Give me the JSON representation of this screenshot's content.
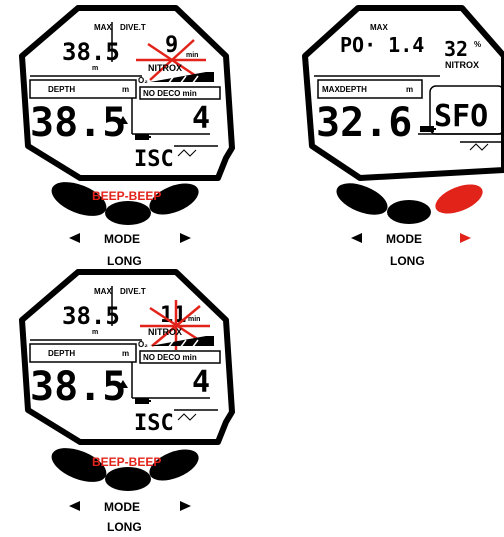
{
  "panel1": {
    "max_label": "MAX",
    "dive_t_label": "DIVE.T",
    "max_depth": "38.5",
    "unit_m": "m",
    "dive_time": "9",
    "unit_min": "min",
    "nitrox_label": "NITROX",
    "o2_label": "O₂",
    "depth_label": "DEPTH",
    "depth_unit": "m",
    "no_deco_label": "NO DECO min",
    "depth_value": "38.5",
    "no_deco_value": "4",
    "isc_text": "ISC",
    "beep_text": "BEEP-BEEP",
    "mode_text": "MODE",
    "long_text": "LONG"
  },
  "panel2": {
    "max_label": "MAX",
    "po_value": "PO· 1.4",
    "o2_percent": "32",
    "percent_sign": "%",
    "nitrox_label": "NITROX",
    "maxdepth_label": "MAXDEPTH",
    "depth_unit": "m",
    "maxdepth_value": "32.6",
    "sfo_text": "SFO",
    "mode_text": "MODE",
    "long_text": "LONG"
  },
  "panel3": {
    "max_label": "MAX",
    "dive_t_label": "DIVE.T",
    "max_depth": "38.5",
    "unit_m": "m",
    "dive_time": "11",
    "unit_min": "min",
    "nitrox_label": "NITROX",
    "o2_label": "O₂",
    "depth_label": "DEPTH",
    "depth_unit": "m",
    "no_deco_label": "NO DECO min",
    "depth_value": "38.5",
    "no_deco_value": "4",
    "isc_text": "ISC",
    "beep_text": "BEEP-BEEP",
    "mode_text": "MODE",
    "long_text": "LONG"
  },
  "colors": {
    "alarm_red": "#e2231a",
    "ink": "#000000"
  },
  "icons": [
    "arrow-left-icon",
    "arrow-right-icon",
    "battery-icon",
    "wave-icon",
    "up-arrow-icon",
    "alarm-flash-icon"
  ]
}
